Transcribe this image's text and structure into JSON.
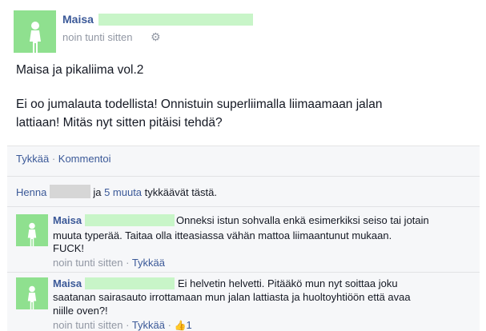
{
  "post": {
    "author": "Maisa",
    "timestamp": "noin tunti sitten",
    "gear_icon": "gear-icon",
    "lines": [
      "Maisa ja pikaliima vol.2",
      "Ei oo jumalauta todellista! Onnistuin superliimalla liimaamaan jalan",
      "lattiaan! Mitäs nyt sitten pitäisi tehdä?"
    ]
  },
  "actions": {
    "like": "Tykkää",
    "separator": "·",
    "comment": "Kommentoi"
  },
  "likes": {
    "name": "Henna",
    "and": "ja",
    "others": "5 muuta",
    "suffix": "tykkäävät tästä."
  },
  "comments": [
    {
      "author": "Maisa",
      "lines": [
        "Onneksi istun sohvalla enkä esimerkiksi seiso tai jotain",
        "muuta typerää. Taitaa olla itteasiassa vähän mattoa liimaantunut mukaan.",
        "FUCK!"
      ],
      "timestamp": "noin tunti sitten",
      "like": "Tykkää"
    },
    {
      "author": "Maisa",
      "lines": [
        "Ei helvetin helvetti. Pitääkö mun nyt soittaa joku",
        "saatanan sairasauto irrottamaan mun jalan lattiasta ja huoltoyhtiöön että avaa",
        "niille oven?!"
      ],
      "timestamp": "noin tunti sitten",
      "like": "Tykkää",
      "like_count": "1",
      "thumb_icon": "thumbs-up-icon"
    }
  ],
  "colors": {
    "link": "#3b5998",
    "avatar_bg": "#8fe08f",
    "redaction": "#c8f5c8",
    "muted": "#9197a3"
  }
}
